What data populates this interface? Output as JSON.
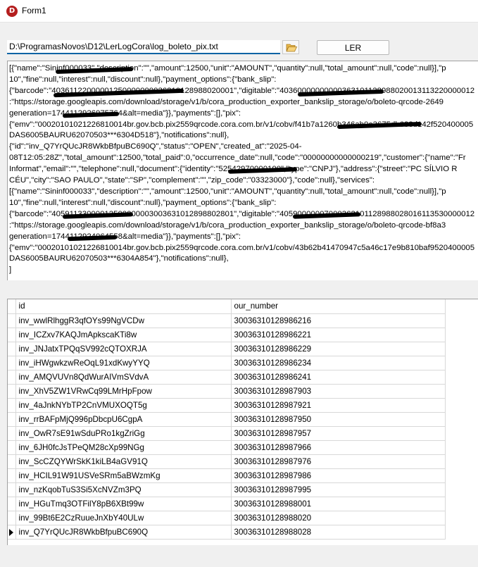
{
  "window": {
    "title": "Form1",
    "icon_letter": "D"
  },
  "toolbar": {
    "file_path": "D:\\ProgramasNovos\\D12\\LerLogCora\\log_boleto_pix.txt",
    "read_button_label": "LER"
  },
  "memo": {
    "lines": [
      "[{\"name\":\"Sininf000033\",\"description\":\"\",\"amount\":12500,\"unit\":\"AMOUNT\",\"quantity\":null,\"total_amount\":null,\"code\":null}],\"p",
      "10\",\"fine\":null,\"interest\":null,\"discount\":null},\"payment_options\":{\"bank_slip\":",
      "{\"barcode\":\"40361122000001250000000036310128988020001\",\"digitable\":\"40360000000000363101128988020013113220000012",
      ":\"https://storage.googleapis.com/download/storage/v1/b/cora_production_exporter_bankslip_storage/o/boleto-qrcode-2649",
      "generation=1744112926075764&alt=media\"}},\"payments\":[],\"pix\":",
      "{\"emv\":\"00020101021226810014br.gov.bcb.pix2559qrcode.cora.com.br/v1/cobv/f41b7a1260b346ab0e3675db638d142f520400005",
      "DAS6005BAURU62070503***6304D518\"},\"notifications\":null},",
      "{\"id\":\"inv_Q7YrQUcJR8WkbBfpuBC690Q\",\"status\":\"OPEN\",\"created_at\":\"2025-04-",
      "08T12:05:28Z\",\"total_amount\":12500,\"total_paid\":0,\"occurrence_date\":null,\"code\":\"00000000000000219\",\"customer\":{\"name\":\"Fr",
      "Informat\",\"email\":\"\",\"telephone\":null,\"document\":{\"identity\":\"52542970000100\",\"type\":\"CNPJ\"},\"address\":{\"street\":\"PC SÍLVIO R",
      "CÉU\",\"city\":\"SAO PAULO\",\"state\":\"SP\",\"complement\":\"\",\"zip_code\":\"03323000\"},\"code\":null},\"services\":",
      "[{\"name\":\"Sininf000033\",\"description\":\"\",\"amount\":12500,\"unit\":\"AMOUNT\",\"quantity\":null,\"total_amount\":null,\"code\":null}],\"p",
      "10\",\"fine\":null,\"interest\":null,\"discount\":null},\"payment_options\":{\"bank_slip\":",
      "{\"barcode\":\"40591133000012500000003003631012898802801\",\"digitable\":\"40590000007000363101128988028016113530000012",
      ":\"https://storage.googleapis.com/download/storage/v1/b/cora_production_exporter_bankslip_storage/o/boleto-qrcode-bf8a3",
      "generation=1744112924064558&alt=media\"}},\"payments\":[],\"pix\":",
      "{\"emv\":\"00020101021226810014br.gov.bcb.pix2559qrcode.cora.com.br/v1/cobv/43b62b41470947c5a46c17e9b810baf9520400005",
      "DAS6005BAURU62070503***6304A854\"},\"notifications\":null},",
      "]"
    ]
  },
  "grid": {
    "columns": [
      "id",
      "our_number"
    ],
    "rows": [
      [
        "inv_wwlRlhggR3qfOYs99NgVCDw",
        "30036310128986216"
      ],
      [
        "inv_ICZxv7KAQJmApkscaKTi8w",
        "30036310128986221"
      ],
      [
        "inv_JNJatxTPQqSV992cQTOXRJA",
        "30036310128986229"
      ],
      [
        "inv_iHWgwkzwReOqL91xdKwyYYQ",
        "30036310128986234"
      ],
      [
        "inv_AMQVUVn8QdWurAIVmSVdvA",
        "30036310128986241"
      ],
      [
        "inv_XhV5ZW1VRwCq99LMrHpFpow",
        "30036310128987903"
      ],
      [
        "inv_4aJnkNYbTP2CnVMUXOQT5g",
        "30036310128987921"
      ],
      [
        "inv_rrBAFpMjQ996pDbcpU6CgpA",
        "30036310128987950"
      ],
      [
        "inv_OwR7sE91wSduPRo1kgZriGg",
        "30036310128987957"
      ],
      [
        "inv_6JH0fcJsTPeQM28cXp99NGg",
        "30036310128987966"
      ],
      [
        "inv_ScCZQYWrSkK1kiLB4aGV91Q",
        "30036310128987976"
      ],
      [
        "inv_HCIL91W91USVeSRm5aBWzmKg",
        "30036310128987986"
      ],
      [
        "inv_nzKqobTuS3Si5XcNVZm3PQ",
        "30036310128987995"
      ],
      [
        "inv_HGuTmq3OTFilY8pB6XBt99w",
        "30036310128988001"
      ],
      [
        "inv_99Bt6E2CzRuueJnXbY40ULw",
        "30036310128988020"
      ],
      [
        "inv_Q7YrQUcJR8WkbBfpuBC690Q",
        "30036310128988028"
      ]
    ],
    "current_row_index": 15
  }
}
